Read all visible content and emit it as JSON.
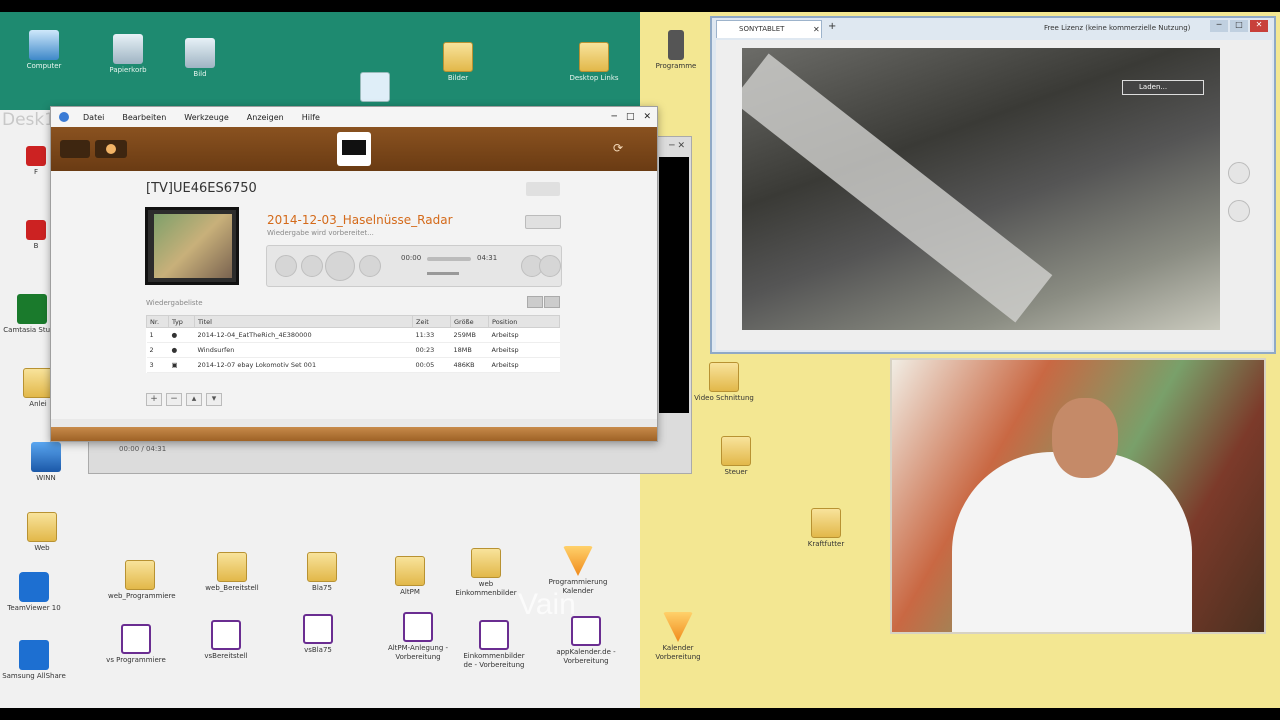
{
  "desktop": {
    "label": "Desk1",
    "watermark": "Vain",
    "icons_top": [
      {
        "label": "Computer"
      },
      {
        "label": "Papierkorb"
      },
      {
        "label": "Bild"
      },
      {
        "label": ""
      },
      {
        "label": "Bilder"
      },
      {
        "label": "Desktop Links"
      },
      {
        "label": "Programme"
      }
    ],
    "icons_left": [
      {
        "label": "F"
      },
      {
        "label": "B"
      },
      {
        "label": "Camtasia Studio"
      },
      {
        "label": "Anlei"
      },
      {
        "label": "WINN"
      },
      {
        "label": "Web"
      },
      {
        "label": "TeamViewer 10"
      },
      {
        "label": "Samsung AllShare"
      }
    ],
    "icons_bottom_row1": [
      {
        "label": "web_Programmiere"
      },
      {
        "label": "web_Bereitstell"
      },
      {
        "label": "Bla75"
      },
      {
        "label": "AltPM"
      },
      {
        "label": "web Einkommenbilder"
      },
      {
        "label": "Programmierung Kalender"
      }
    ],
    "icons_bottom_row2": [
      {
        "label": "vs Programmiere"
      },
      {
        "label": "vsBereitstell"
      },
      {
        "label": "vsBla75"
      },
      {
        "label": "AltPM-Anlegung - Vorbereitung"
      },
      {
        "label": "Einkommenbilder de - Vorbereitung"
      },
      {
        "label": "appKalender.de - Vorbereitung"
      }
    ],
    "icons_right": [
      {
        "label": "Video Schnittung"
      },
      {
        "label": "Steuer"
      },
      {
        "label": "Kraftfutter"
      },
      {
        "label": "Kalender Vorbereitung"
      }
    ]
  },
  "bg_window": {
    "footer": "00:00 / 04:31"
  },
  "app": {
    "menu": [
      "Datei",
      "Bearbeiten",
      "Werkzeuge",
      "Anzeigen",
      "Hilfe"
    ],
    "device": "[TV]UE46ES6750",
    "track_title": "2014-12-03_Haselnüsse_Radar",
    "track_status": "Wiedergabe wird vorbereitet...",
    "time_start": "00:00",
    "time_end": "04:31",
    "progress": 0.0,
    "playlist_label": "Wiedergabeliste",
    "columns": [
      "Nr.",
      "Typ",
      "Titel",
      "Zeit",
      "Größe",
      "Position"
    ],
    "rows": [
      {
        "nr": "1",
        "typ": "video",
        "titel": "2014-12-04_EatTheRich_4E380000",
        "zeit": "11:33",
        "groesse": "259MB",
        "pos": "Arbeitsp"
      },
      {
        "nr": "2",
        "typ": "video",
        "titel": "Windsurfen",
        "zeit": "00:23",
        "groesse": "18MB",
        "pos": "Arbeitsp"
      },
      {
        "nr": "3",
        "typ": "image",
        "titel": "2014-12-07 ebay Lokomotiv Set 001",
        "zeit": "00:05",
        "groesse": "486KB",
        "pos": "Arbeitsp"
      }
    ]
  },
  "browser": {
    "tab_title": "SONYTABLET",
    "license_text": "Free Lizenz (keine kommerzielle Nutzung)",
    "loading_label": "Laden..."
  }
}
